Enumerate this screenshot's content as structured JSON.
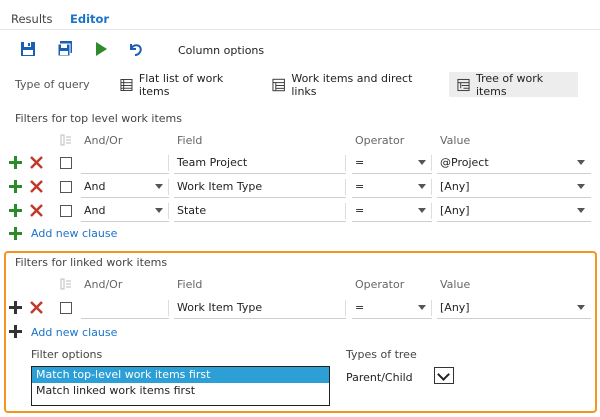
{
  "tabs": {
    "results": "Results",
    "editor": "Editor"
  },
  "toolbar": {
    "column_options": "Column options",
    "icons": [
      "save-icon",
      "save-all-icon",
      "run-icon",
      "undo-icon"
    ],
    "accent_green": "#2d8a2d",
    "accent_blue": "#1a5fb4"
  },
  "query_type": {
    "label": "Type of query",
    "options": [
      "Flat list of work items",
      "Work items and direct links",
      "Tree of work items"
    ],
    "selected": "Tree of work items"
  },
  "top_filters": {
    "title": "Filters for top level work items",
    "headers": {
      "andor": "And/Or",
      "field": "Field",
      "operator": "Operator",
      "value": "Value"
    },
    "rows": [
      {
        "andor": "",
        "field": "Team Project",
        "operator": "=",
        "value": "@Project"
      },
      {
        "andor": "And",
        "field": "Work Item Type",
        "operator": "=",
        "value": "[Any]"
      },
      {
        "andor": "And",
        "field": "State",
        "operator": "=",
        "value": "[Any]"
      }
    ],
    "add_clause": "Add new clause"
  },
  "linked_filters": {
    "title": "Filters for linked work items",
    "headers": {
      "andor": "And/Or",
      "field": "Field",
      "operator": "Operator",
      "value": "Value"
    },
    "rows": [
      {
        "andor": "",
        "field": "Work Item Type",
        "operator": "=",
        "value": "[Any]"
      }
    ],
    "add_clause": "Add new clause",
    "highlight_color": "#f7941d"
  },
  "filter_options": {
    "label": "Filter options",
    "options": [
      "Match top-level work items first",
      "Match linked work items first"
    ],
    "selected": "Match top-level work items first"
  },
  "tree_types": {
    "label": "Types of tree",
    "value": "Parent/Child"
  }
}
